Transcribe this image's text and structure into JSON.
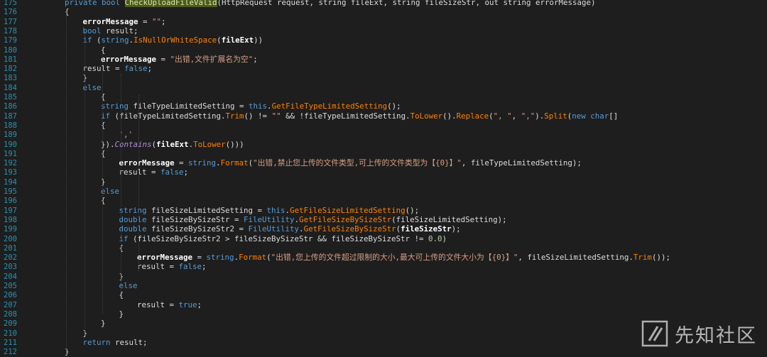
{
  "editor": {
    "lines": [
      {
        "num": "175",
        "tokens": [
          [
            "kw",
            "private bool "
          ],
          [
            "hl",
            "CheckUploadFileValid"
          ],
          [
            "pl",
            "(HttpRequest request, string fileExt, string fileSizeStr, out string errorMessage)"
          ]
        ]
      },
      {
        "num": "176",
        "tokens": [
          [
            "pl",
            "{"
          ]
        ]
      },
      {
        "num": "177",
        "tokens": [
          [
            "var",
            "errorMessage"
          ],
          [
            "pl",
            " = "
          ],
          [
            "str",
            "\"\""
          ],
          [
            "pl",
            ";"
          ]
        ]
      },
      {
        "num": "178",
        "tokens": [
          [
            "kw",
            "bool"
          ],
          [
            "pl",
            " result;"
          ]
        ]
      },
      {
        "num": "179",
        "tokens": [
          [
            "kw",
            "if"
          ],
          [
            "pl",
            " ("
          ],
          [
            "kw",
            "string"
          ],
          [
            "pl",
            "."
          ],
          [
            "mth",
            "IsNullOrWhiteSpace"
          ],
          [
            "pl",
            "("
          ],
          [
            "var",
            "fileExt"
          ],
          [
            "pl",
            "))"
          ]
        ]
      },
      {
        "num": "180",
        "tokens": [
          [
            "pl",
            "{"
          ]
        ]
      },
      {
        "num": "181",
        "tokens": [
          [
            "var",
            "errorMessage"
          ],
          [
            "pl",
            " = "
          ],
          [
            "str",
            "\"出错,文件扩展名为空\""
          ],
          [
            "pl",
            ";"
          ]
        ]
      },
      {
        "num": "182",
        "tokens": [
          [
            "pl",
            "result = "
          ],
          [
            "kw",
            "false"
          ],
          [
            "pl",
            ";"
          ]
        ]
      },
      {
        "num": "183",
        "tokens": [
          [
            "pl",
            "}"
          ]
        ]
      },
      {
        "num": "184",
        "tokens": [
          [
            "kw",
            "else"
          ]
        ]
      },
      {
        "num": "185",
        "tokens": [
          [
            "pl",
            "{"
          ]
        ]
      },
      {
        "num": "186",
        "tokens": [
          [
            "kw",
            "string"
          ],
          [
            "pl",
            " fileTypeLimitedSetting = "
          ],
          [
            "kw",
            "this"
          ],
          [
            "pl",
            "."
          ],
          [
            "mth",
            "GetFileTypeLimitedSetting"
          ],
          [
            "pl",
            "();"
          ]
        ]
      },
      {
        "num": "187",
        "tokens": [
          [
            "kw",
            "if"
          ],
          [
            "pl",
            " (fileTypeLimitedSetting."
          ],
          [
            "mth",
            "Trim"
          ],
          [
            "pl",
            "() != "
          ],
          [
            "str",
            "\"\""
          ],
          [
            "pl",
            " && !fileTypeLimitedSetting."
          ],
          [
            "mth",
            "ToLower"
          ],
          [
            "pl",
            "()."
          ],
          [
            "mth",
            "Replace"
          ],
          [
            "pl",
            "("
          ],
          [
            "str",
            "\", \""
          ],
          [
            "pl",
            ", "
          ],
          [
            "str",
            "\",\""
          ],
          [
            "pl",
            ")."
          ],
          [
            "mth",
            "Split"
          ],
          [
            "pl",
            "("
          ],
          [
            "kw",
            "new char"
          ],
          [
            "pl",
            "[]"
          ]
        ]
      },
      {
        "num": "188",
        "tokens": [
          [
            "pl",
            "{"
          ]
        ]
      },
      {
        "num": "189",
        "tokens": [
          [
            "str",
            "','"
          ]
        ]
      },
      {
        "num": "190",
        "tokens": [
          [
            "pl",
            "})."
          ],
          [
            "ital",
            "Contains"
          ],
          [
            "pl",
            "("
          ],
          [
            "var",
            "fileExt"
          ],
          [
            "pl",
            "."
          ],
          [
            "mth",
            "ToLower"
          ],
          [
            "pl",
            "()))"
          ]
        ]
      },
      {
        "num": "191",
        "tokens": [
          [
            "pl",
            "{"
          ]
        ]
      },
      {
        "num": "192",
        "tokens": [
          [
            "var",
            "errorMessage"
          ],
          [
            "pl",
            " = "
          ],
          [
            "kw",
            "string"
          ],
          [
            "pl",
            "."
          ],
          [
            "mth",
            "Format"
          ],
          [
            "pl",
            "("
          ],
          [
            "str",
            "\"出错,禁止您上传的文件类型,可上传的文件类型为【{0}】\""
          ],
          [
            "pl",
            ", fileTypeLimitedSetting);"
          ]
        ]
      },
      {
        "num": "193",
        "tokens": [
          [
            "pl",
            "result = "
          ],
          [
            "kw",
            "false"
          ],
          [
            "pl",
            ";"
          ]
        ]
      },
      {
        "num": "194",
        "tokens": [
          [
            "pl",
            "}"
          ]
        ]
      },
      {
        "num": "195",
        "tokens": [
          [
            "kw",
            "else"
          ]
        ]
      },
      {
        "num": "196",
        "tokens": [
          [
            "pl",
            "{"
          ]
        ]
      },
      {
        "num": "197",
        "tokens": [
          [
            "kw",
            "string"
          ],
          [
            "pl",
            " fileSizeLimitedSetting = "
          ],
          [
            "kw",
            "this"
          ],
          [
            "pl",
            "."
          ],
          [
            "mth",
            "GetFileSizeLimitedSetting"
          ],
          [
            "pl",
            "();"
          ]
        ]
      },
      {
        "num": "198",
        "tokens": [
          [
            "kw",
            "double"
          ],
          [
            "pl",
            " fileSizeBySizeStr = "
          ],
          [
            "kw",
            "FileUtility"
          ],
          [
            "pl",
            "."
          ],
          [
            "mth",
            "GetFileSizeBySizeStr"
          ],
          [
            "pl",
            "(fileSizeLimitedSetting);"
          ]
        ]
      },
      {
        "num": "199",
        "tokens": [
          [
            "kw",
            "double"
          ],
          [
            "pl",
            " fileSizeBySizeStr2 = "
          ],
          [
            "kw",
            "FileUtility"
          ],
          [
            "pl",
            "."
          ],
          [
            "mth",
            "GetFileSizeBySizeStr"
          ],
          [
            "pl",
            "("
          ],
          [
            "var",
            "fileSizeStr"
          ],
          [
            "pl",
            ");"
          ]
        ]
      },
      {
        "num": "200",
        "tokens": [
          [
            "kw",
            "if"
          ],
          [
            "pl",
            " (fileSizeBySizeStr2 > fileSizeBySizeStr && fileSizeBySizeStr != "
          ],
          [
            "num",
            "0.0"
          ],
          [
            "pl",
            ")"
          ]
        ]
      },
      {
        "num": "201",
        "tokens": [
          [
            "pl",
            "{"
          ]
        ]
      },
      {
        "num": "202",
        "tokens": [
          [
            "var",
            "errorMessage"
          ],
          [
            "pl",
            " = "
          ],
          [
            "kw",
            "string"
          ],
          [
            "pl",
            "."
          ],
          [
            "mth",
            "Format"
          ],
          [
            "pl",
            "("
          ],
          [
            "str",
            "\"出错,您上传的文件超过限制的大小,最大可上传的文件大小为【{0}】\""
          ],
          [
            "pl",
            ", fileSizeLimitedSetting."
          ],
          [
            "mth",
            "Trim"
          ],
          [
            "pl",
            "());"
          ]
        ]
      },
      {
        "num": "203",
        "tokens": [
          [
            "pl",
            "result = "
          ],
          [
            "kw",
            "false"
          ],
          [
            "pl",
            ";"
          ]
        ]
      },
      {
        "num": "204",
        "tokens": [
          [
            "pl",
            "}"
          ]
        ]
      },
      {
        "num": "205",
        "tokens": [
          [
            "kw",
            "else"
          ]
        ]
      },
      {
        "num": "206",
        "tokens": [
          [
            "pl",
            "{"
          ]
        ]
      },
      {
        "num": "207",
        "tokens": [
          [
            "pl",
            "result = "
          ],
          [
            "kw",
            "true"
          ],
          [
            "pl",
            ";"
          ]
        ]
      },
      {
        "num": "208",
        "tokens": [
          [
            "pl",
            "}"
          ]
        ]
      },
      {
        "num": "209",
        "tokens": [
          [
            "pl",
            "}"
          ]
        ]
      },
      {
        "num": "210",
        "tokens": [
          [
            "pl",
            "}"
          ]
        ]
      },
      {
        "num": "211",
        "tokens": [
          [
            "kw",
            "return"
          ],
          [
            "pl",
            " result;"
          ]
        ]
      },
      {
        "num": "212",
        "tokens": [
          [
            "pl",
            "}"
          ]
        ]
      }
    ]
  },
  "watermark": {
    "text": "先知社区",
    "icon": "xianzhi-logo-icon"
  },
  "colors": {
    "background": "#1e1e1e",
    "line_number": "#2b91af",
    "keyword": "#569cd6",
    "string": "#d69d85",
    "method": "#ff8000",
    "variable": "#ffffff",
    "highlight": "#4b5a1e"
  }
}
